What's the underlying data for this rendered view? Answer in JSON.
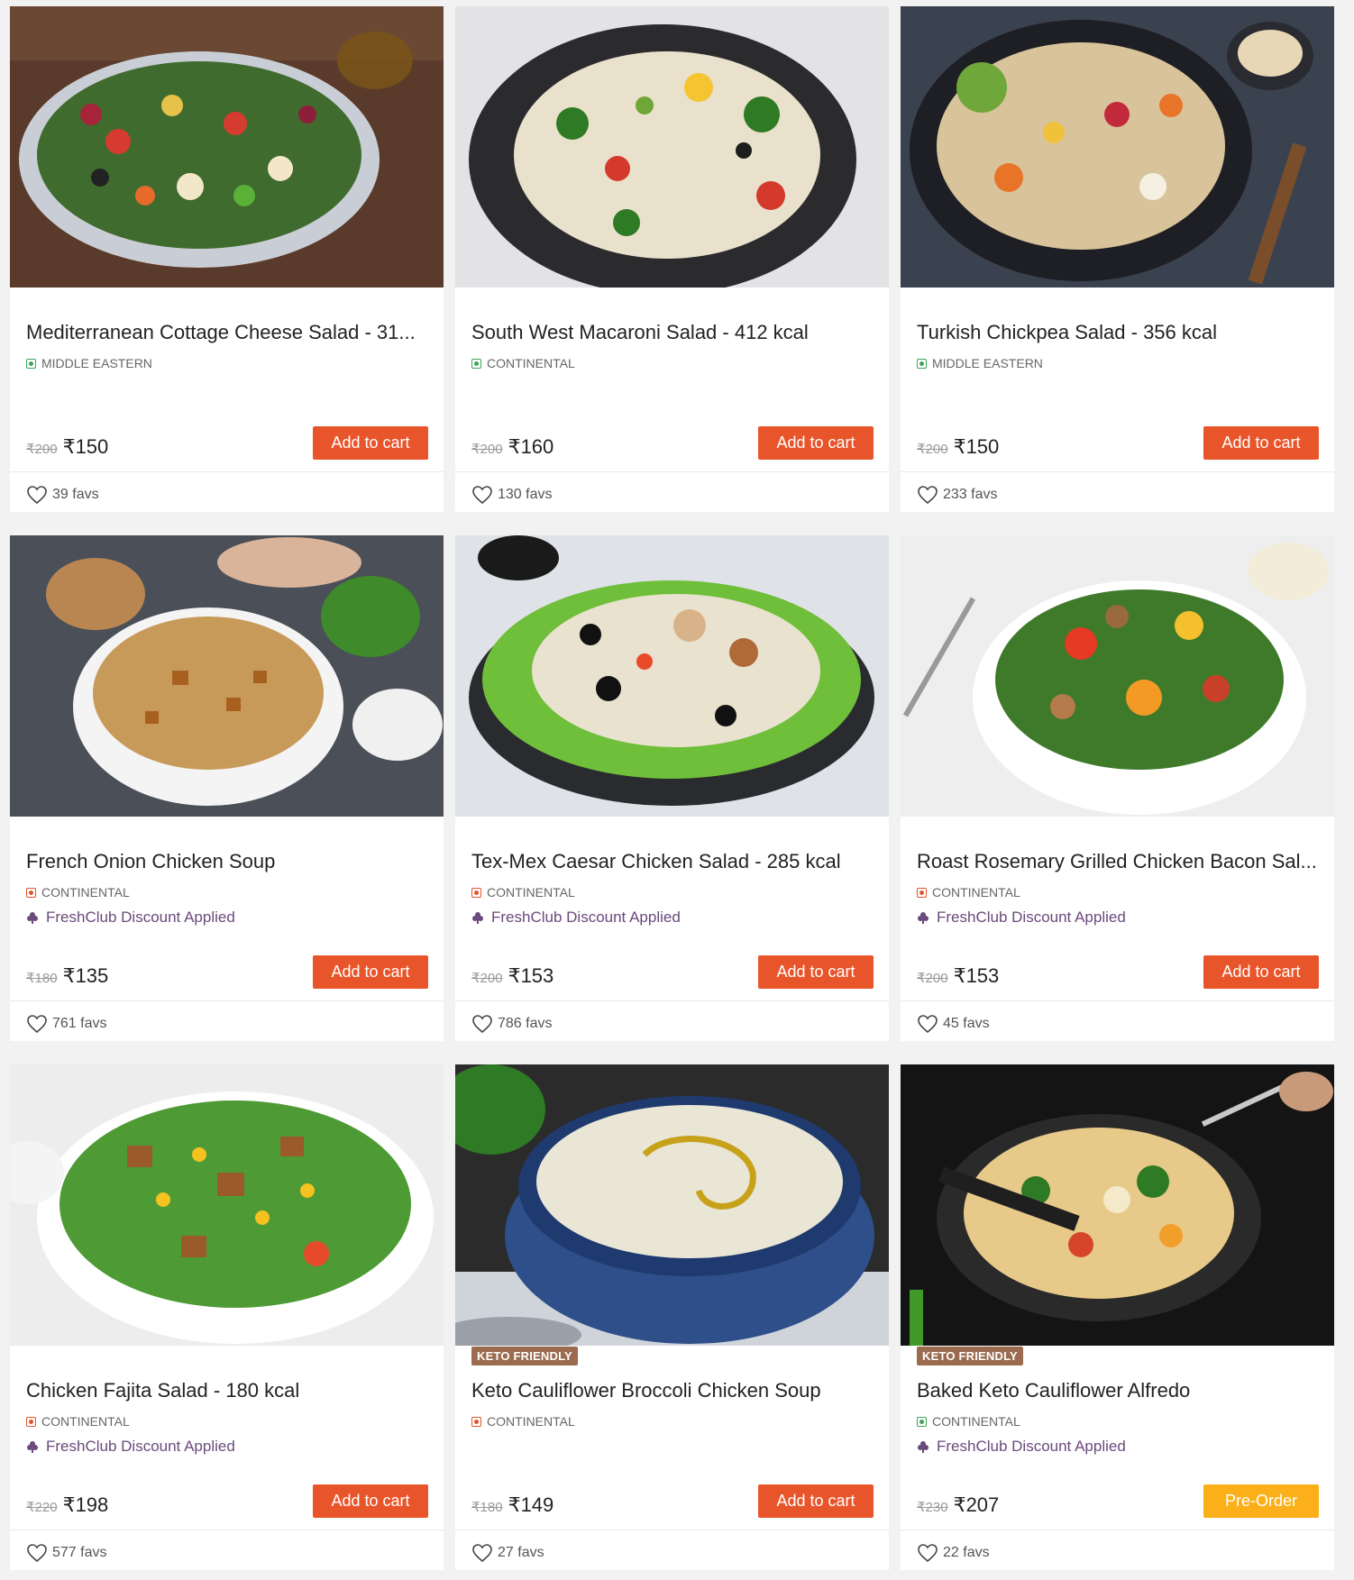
{
  "colors": {
    "accent": "#e9552b",
    "preorder": "#fbb019",
    "veg": "#3ba65a",
    "nonveg": "#e5532d",
    "discount": "#6a4a7c",
    "keto_badge": "#9a6b4f"
  },
  "products": [
    {
      "name": "Mediterranean Cottage Cheese Salad - 31...",
      "cuisine": "MIDDLE EASTERN",
      "diet": "veg",
      "badge": "",
      "discount": "",
      "mrp": "₹200",
      "price": "₹150",
      "cta": "Add to cart",
      "favs": "39 favs",
      "image": "salad-with-paneer-image"
    },
    {
      "name": "South West Macaroni Salad - 412 kcal",
      "cuisine": "CONTINENTAL",
      "diet": "veg",
      "badge": "",
      "discount": "",
      "mrp": "₹200",
      "price": "₹160",
      "cta": "Add to cart",
      "favs": "130 favs",
      "image": "macaroni-salad-image"
    },
    {
      "name": "Turkish Chickpea Salad - 356 kcal",
      "cuisine": "MIDDLE EASTERN",
      "diet": "veg",
      "badge": "",
      "discount": "",
      "mrp": "₹200",
      "price": "₹150",
      "cta": "Add to cart",
      "favs": "233 favs",
      "image": "chickpea-salad-image"
    },
    {
      "name": "French Onion Chicken Soup",
      "cuisine": "CONTINENTAL",
      "diet": "nonveg",
      "badge": "",
      "discount": "FreshClub Discount Applied",
      "mrp": "₹180",
      "price": "₹135",
      "cta": "Add to cart",
      "favs": "761 favs",
      "image": "onion-soup-image"
    },
    {
      "name": "Tex-Mex Caesar Chicken Salad - 285 kcal",
      "cuisine": "CONTINENTAL",
      "diet": "nonveg",
      "badge": "",
      "discount": "FreshClub Discount Applied",
      "mrp": "₹200",
      "price": "₹153",
      "cta": "Add to cart",
      "favs": "786 favs",
      "image": "caesar-salad-image"
    },
    {
      "name": "Roast Rosemary Grilled Chicken Bacon Sal...",
      "cuisine": "CONTINENTAL",
      "diet": "nonveg",
      "badge": "",
      "discount": "FreshClub Discount Applied",
      "mrp": "₹200",
      "price": "₹153",
      "cta": "Add to cart",
      "favs": "45 favs",
      "image": "grilled-chicken-salad-image"
    },
    {
      "name": "Chicken Fajita Salad - 180 kcal",
      "cuisine": "CONTINENTAL",
      "diet": "nonveg",
      "badge": "",
      "discount": "FreshClub Discount Applied",
      "mrp": "₹220",
      "price": "₹198",
      "cta": "Add to cart",
      "favs": "577 favs",
      "image": "fajita-salad-image"
    },
    {
      "name": "Keto Cauliflower Broccoli Chicken Soup",
      "cuisine": "CONTINENTAL",
      "diet": "nonveg",
      "badge": "KETO FRIENDLY",
      "discount": "",
      "mrp": "₹180",
      "price": "₹149",
      "cta": "Add to cart",
      "favs": "27 favs",
      "image": "cauliflower-soup-image"
    },
    {
      "name": "Baked Keto Cauliflower Alfredo",
      "cuisine": "CONTINENTAL",
      "diet": "veg",
      "badge": "KETO FRIENDLY",
      "discount": "FreshClub Discount Applied",
      "mrp": "₹230",
      "price": "₹207",
      "cta": "Pre-Order",
      "favs": "22 favs",
      "image": "cauliflower-alfredo-image"
    }
  ]
}
